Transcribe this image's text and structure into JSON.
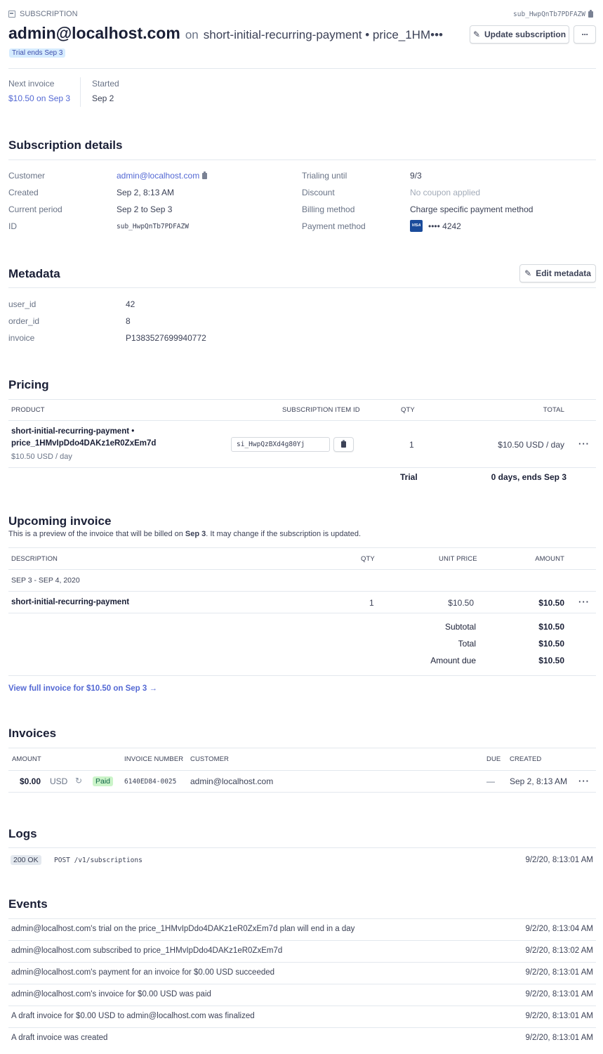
{
  "header": {
    "label": "SUBSCRIPTION",
    "sub_id": "sub_HwpQnTb7PDFAZW",
    "customer_email": "admin@localhost.com",
    "on_word": "on",
    "plan_text": "short-initial-recurring-payment • price_1HM•••",
    "trial_badge": "Trial ends Sep 3",
    "update_button": "Update subscription",
    "more_button": "···"
  },
  "summary": {
    "next_invoice_label": "Next invoice",
    "next_invoice_value": "$10.50 on Sep 3",
    "started_label": "Started",
    "started_value": "Sep 2"
  },
  "details": {
    "title": "Subscription details",
    "left": [
      {
        "label": "Customer",
        "value": "admin@localhost.com"
      },
      {
        "label": "Created",
        "value": "Sep 2, 8:13 AM"
      },
      {
        "label": "Current period",
        "value": "Sep 2 to Sep 3"
      },
      {
        "label": "ID",
        "value": "sub_HwpQnTb7PDFAZW"
      }
    ],
    "right": [
      {
        "label": "Trialing until",
        "value": "9/3"
      },
      {
        "label": "Discount",
        "value": "No coupon applied"
      },
      {
        "label": "Billing method",
        "value": "Charge specific payment method"
      },
      {
        "label": "Payment method",
        "value": "•••• 4242",
        "card_brand": "VISA"
      }
    ]
  },
  "metadata": {
    "title": "Metadata",
    "edit_button": "Edit metadata",
    "items": [
      {
        "key": "user_id",
        "value": "42"
      },
      {
        "key": "order_id",
        "value": "8"
      },
      {
        "key": "invoice",
        "value": "P1383527699940772"
      }
    ]
  },
  "pricing": {
    "title": "Pricing",
    "headers": {
      "product": "PRODUCT",
      "item_id": "SUBSCRIPTION ITEM ID",
      "qty": "QTY",
      "total": "TOTAL"
    },
    "row": {
      "product_line1": "short-initial-recurring-payment •",
      "product_line2": "price_1HMvIpDdo4DAKz1eR0ZxEm7d",
      "product_price": "$10.50 USD / day",
      "item_id": "si_HwpQzBXd4g80Yj",
      "qty": "1",
      "total": "$10.50 USD / day",
      "more": "···"
    },
    "trial_label": "Trial",
    "trial_value": "0 days, ends Sep 3"
  },
  "upcoming": {
    "title": "Upcoming invoice",
    "desc_prefix": "This is a preview of the invoice that will be billed on ",
    "desc_date": "Sep 3",
    "desc_suffix": ". It may change if the subscription is updated.",
    "headers": {
      "description": "DESCRIPTION",
      "qty": "QTY",
      "unit_price": "UNIT PRICE",
      "amount": "AMOUNT"
    },
    "period": "SEP 3 - SEP 4, 2020",
    "line": {
      "description": "short-initial-recurring-payment",
      "qty": "1",
      "unit_price": "$10.50",
      "amount": "$10.50",
      "more": "···"
    },
    "totals": [
      {
        "label": "Subtotal",
        "value": "$10.50"
      },
      {
        "label": "Total",
        "value": "$10.50"
      },
      {
        "label": "Amount due",
        "value": "$10.50"
      }
    ],
    "view_link": "View full invoice for $10.50 on Sep 3 →"
  },
  "invoices": {
    "title": "Invoices",
    "headers": {
      "amount": "AMOUNT",
      "number": "INVOICE NUMBER",
      "customer": "CUSTOMER",
      "due": "DUE",
      "created": "CREATED"
    },
    "rows": [
      {
        "amount": "$0.00",
        "currency": "USD",
        "status": "Paid",
        "number": "6140ED84-0025",
        "customer": "admin@localhost.com",
        "due": "—",
        "created": "Sep 2, 8:13 AM",
        "more": "···"
      }
    ]
  },
  "logs": {
    "title": "Logs",
    "rows": [
      {
        "status": "200 OK",
        "request": "POST /v1/subscriptions",
        "time": "9/2/20, 8:13:01 AM"
      }
    ]
  },
  "events": {
    "title": "Events",
    "rows": [
      {
        "text": "admin@localhost.com's trial on the price_1HMvIpDdo4DAKz1eR0ZxEm7d plan will end in a day",
        "time": "9/2/20, 8:13:04 AM"
      },
      {
        "text": "admin@localhost.com subscribed to price_1HMvIpDdo4DAKz1eR0ZxEm7d",
        "time": "9/2/20, 8:13:02 AM"
      },
      {
        "text": "admin@localhost.com's payment for an invoice for $0.00 USD succeeded",
        "time": "9/2/20, 8:13:01 AM"
      },
      {
        "text": "admin@localhost.com's invoice for $0.00 USD was paid",
        "time": "9/2/20, 8:13:01 AM"
      },
      {
        "text": "A draft invoice for $0.00 USD to admin@localhost.com was finalized",
        "time": "9/2/20, 8:13:01 AM"
      },
      {
        "text": "A draft invoice was created",
        "time": "9/2/20, 8:13:01 AM"
      }
    ]
  },
  "colors": {
    "accent": "#5469d4",
    "paid_bg": "#cbf4c9",
    "paid_fg": "#0e6245",
    "trial_bg": "#d6ecff",
    "visa": "#1a4b9b"
  }
}
